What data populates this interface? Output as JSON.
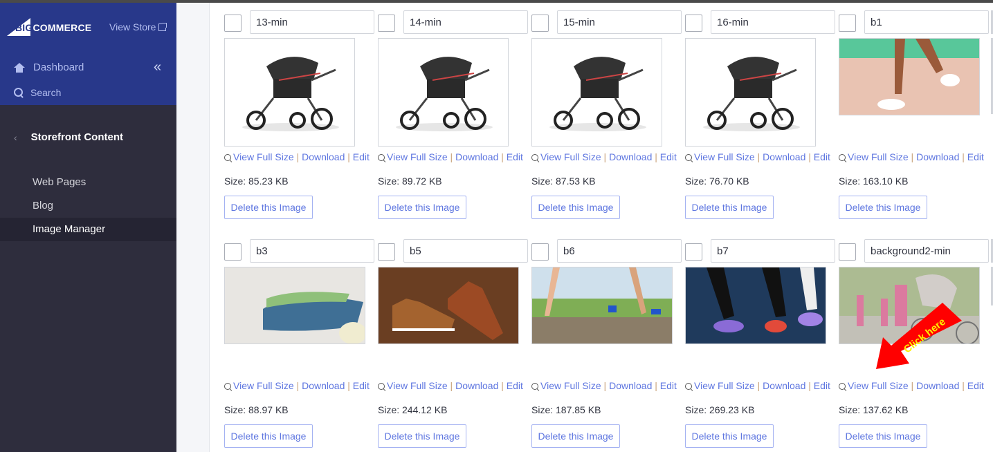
{
  "sidebar": {
    "logo": {
      "prefix": "BIG",
      "suffix": "COMMERCE"
    },
    "view_store": "View Store",
    "nav": [
      {
        "label": "Dashboard",
        "icon": "home-icon"
      },
      {
        "label": "Search",
        "icon": "search-icon"
      }
    ],
    "collapse_glyph": "«",
    "section": {
      "back_glyph": "‹",
      "title": "Storefront Content"
    },
    "items": [
      {
        "label": "Web Pages",
        "active": false
      },
      {
        "label": "Blog",
        "active": false
      },
      {
        "label": "Image Manager",
        "active": true
      }
    ]
  },
  "image_actions": {
    "view_full_size": "View Full Size",
    "download": "Download",
    "edit": "Edit",
    "separator": "|",
    "delete": "Delete this Image",
    "size_prefix": "Size: "
  },
  "images": [
    {
      "name": "13-min",
      "size": "85.23 KB",
      "kind": "stroller-side"
    },
    {
      "name": "14-min",
      "size": "89.72 KB",
      "kind": "stroller-side"
    },
    {
      "name": "15-min",
      "size": "87.53 KB",
      "kind": "stroller-angle"
    },
    {
      "name": "16-min",
      "size": "76.70 KB",
      "kind": "stroller-front"
    },
    {
      "name": "b1",
      "size": "163.10 KB",
      "kind": "walking-feet"
    },
    {
      "name": "b3",
      "size": "88.97 KB",
      "kind": "shoe-sole"
    },
    {
      "name": "b5",
      "size": "244.12 KB",
      "kind": "boots-leaves"
    },
    {
      "name": "b6",
      "size": "187.85 KB",
      "kind": "legs-log"
    },
    {
      "name": "b7",
      "size": "269.23 KB",
      "kind": "runners-splash"
    },
    {
      "name": "background2-min",
      "size": "137.62 KB",
      "kind": "park-jog"
    }
  ],
  "annotation": {
    "text": "Click here",
    "color": "#ff0000",
    "text_color": "#ffee00"
  },
  "colors": {
    "sidebar_header": "#28388a",
    "sidebar": "#2e2d3d",
    "link": "#5e76e0"
  }
}
